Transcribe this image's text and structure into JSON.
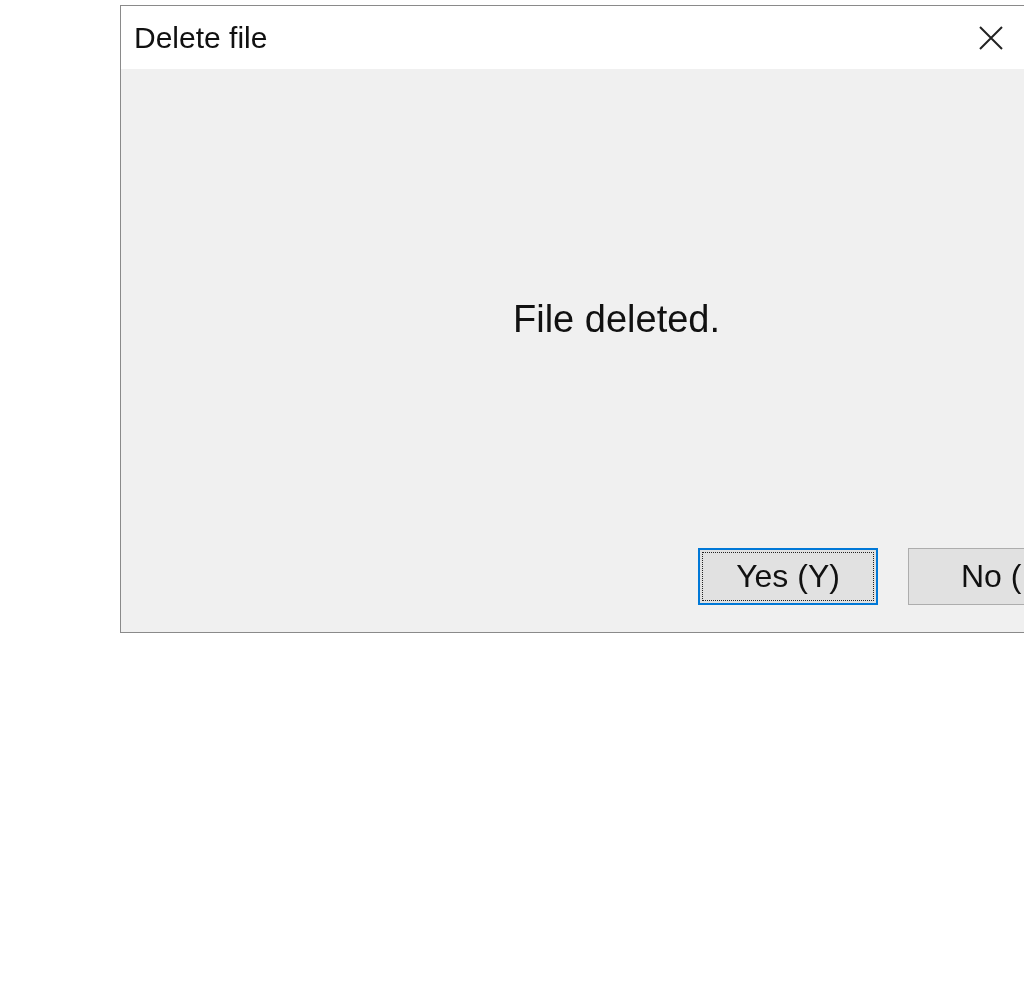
{
  "window": {
    "title": "Delete file"
  },
  "message": "File deleted.",
  "buttons": [
    {
      "label": "Yes (Y)",
      "focused": true
    },
    {
      "label": "No (",
      "focused": false
    }
  ]
}
